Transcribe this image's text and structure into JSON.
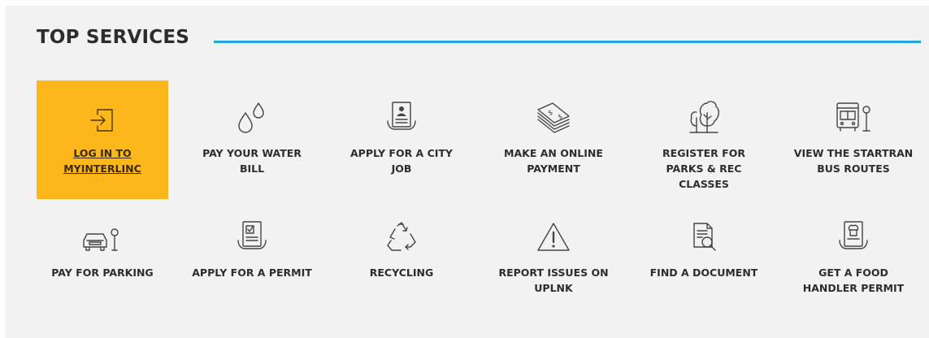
{
  "section": {
    "title": "TOP SERVICES",
    "accent_color": "#1fa8dc",
    "active_color": "#fdb71a"
  },
  "tiles": [
    {
      "label": "LOG IN TO MYINTERLINC",
      "icon": "login-icon"
    },
    {
      "label": "PAY YOUR WATER BILL",
      "icon": "water-drops-icon"
    },
    {
      "label": "APPLY FOR A CITY JOB",
      "icon": "job-application-icon"
    },
    {
      "label": "MAKE AN ONLINE PAYMENT",
      "icon": "money-stack-icon"
    },
    {
      "label": "REGISTER FOR PARKS & REC CLASSES",
      "icon": "trees-icon"
    },
    {
      "label": "VIEW THE STARTRAN BUS ROUTES",
      "icon": "bus-stop-icon"
    },
    {
      "label": "PAY FOR PARKING",
      "icon": "car-parking-icon"
    },
    {
      "label": "APPLY FOR A PERMIT",
      "icon": "permit-icon"
    },
    {
      "label": "RECYCLING",
      "icon": "recycle-icon"
    },
    {
      "label": "REPORT ISSUES ON UPLNK",
      "icon": "warning-icon"
    },
    {
      "label": "FIND A DOCUMENT",
      "icon": "document-search-icon"
    },
    {
      "label": "GET A FOOD HANDLER PERMIT",
      "icon": "food-permit-icon"
    }
  ]
}
